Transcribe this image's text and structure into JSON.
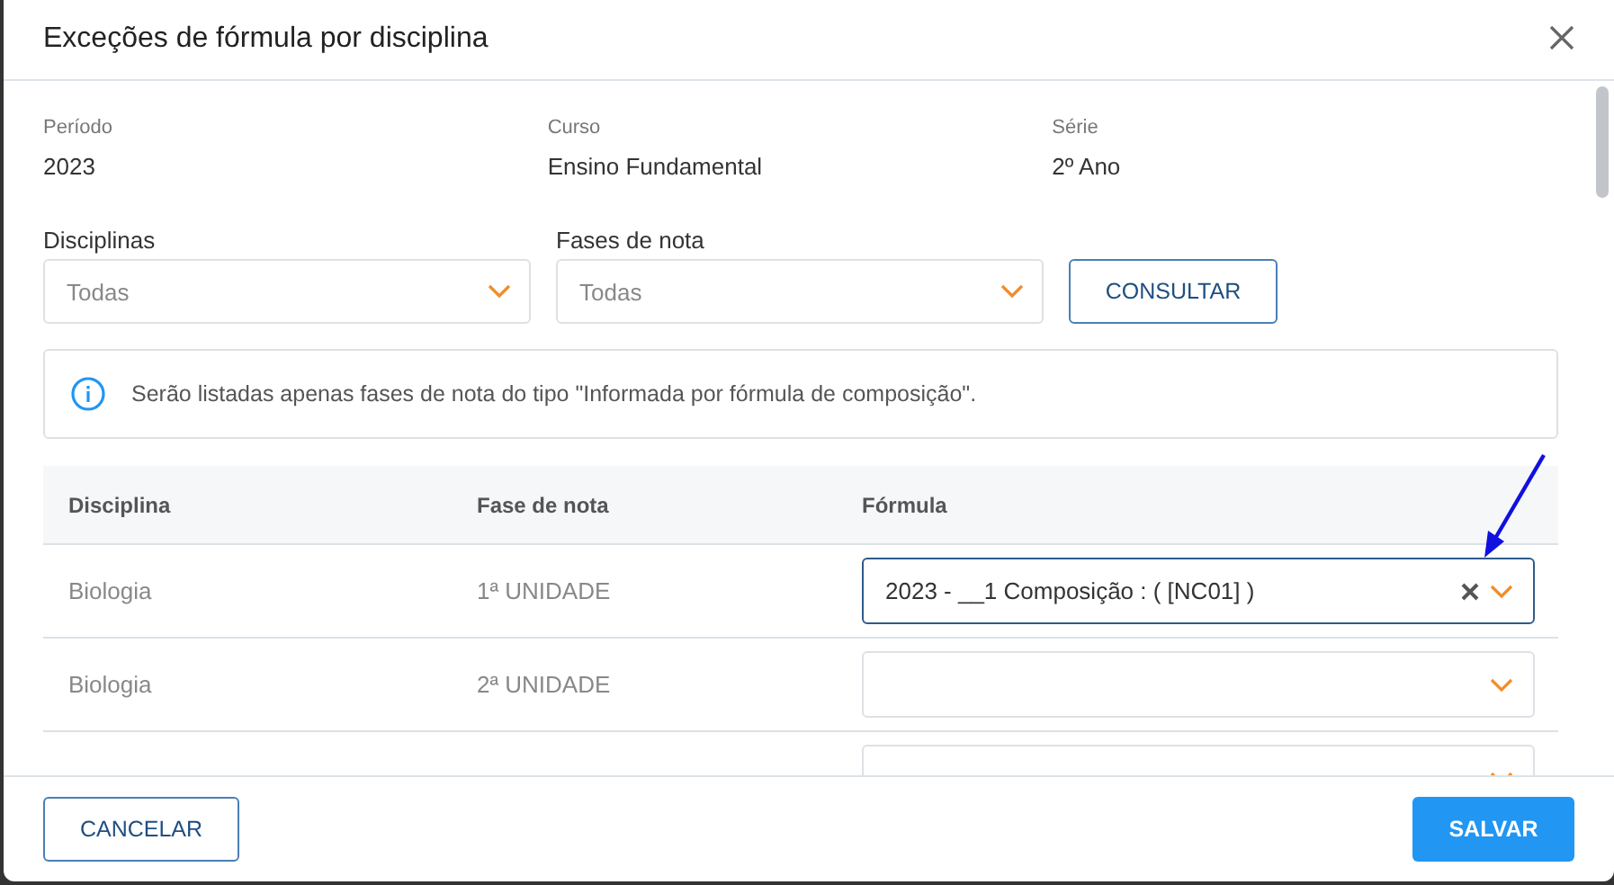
{
  "dialog": {
    "title": "Exceções de fórmula por disciplina"
  },
  "info": [
    {
      "label": "Período",
      "value": "2023"
    },
    {
      "label": "Curso",
      "value": "Ensino Fundamental"
    },
    {
      "label": "Série",
      "value": "2º Ano"
    }
  ],
  "filters": [
    {
      "label": "Disciplinas",
      "placeholder": "Todas"
    },
    {
      "label": "Fases de nota",
      "placeholder": "Todas"
    }
  ],
  "query_button": "CONSULTAR",
  "notice": "Serão listadas apenas fases de nota do tipo \"Informada por fórmula de composição\".",
  "table": {
    "columns": [
      "Disciplina",
      "Fase de nota",
      "Fórmula"
    ],
    "rows": [
      {
        "disciplina": "Biologia",
        "fase": "1ª UNIDADE",
        "formula": "2023 - __1 Composição : ( [NC01] )",
        "focused": true
      },
      {
        "disciplina": "Biologia",
        "fase": "2ª UNIDADE",
        "formula": "",
        "focused": false
      },
      {
        "formula": "",
        "focused": false
      }
    ]
  },
  "footer": {
    "cancel": "CANCELAR",
    "save": "SALVAR"
  }
}
